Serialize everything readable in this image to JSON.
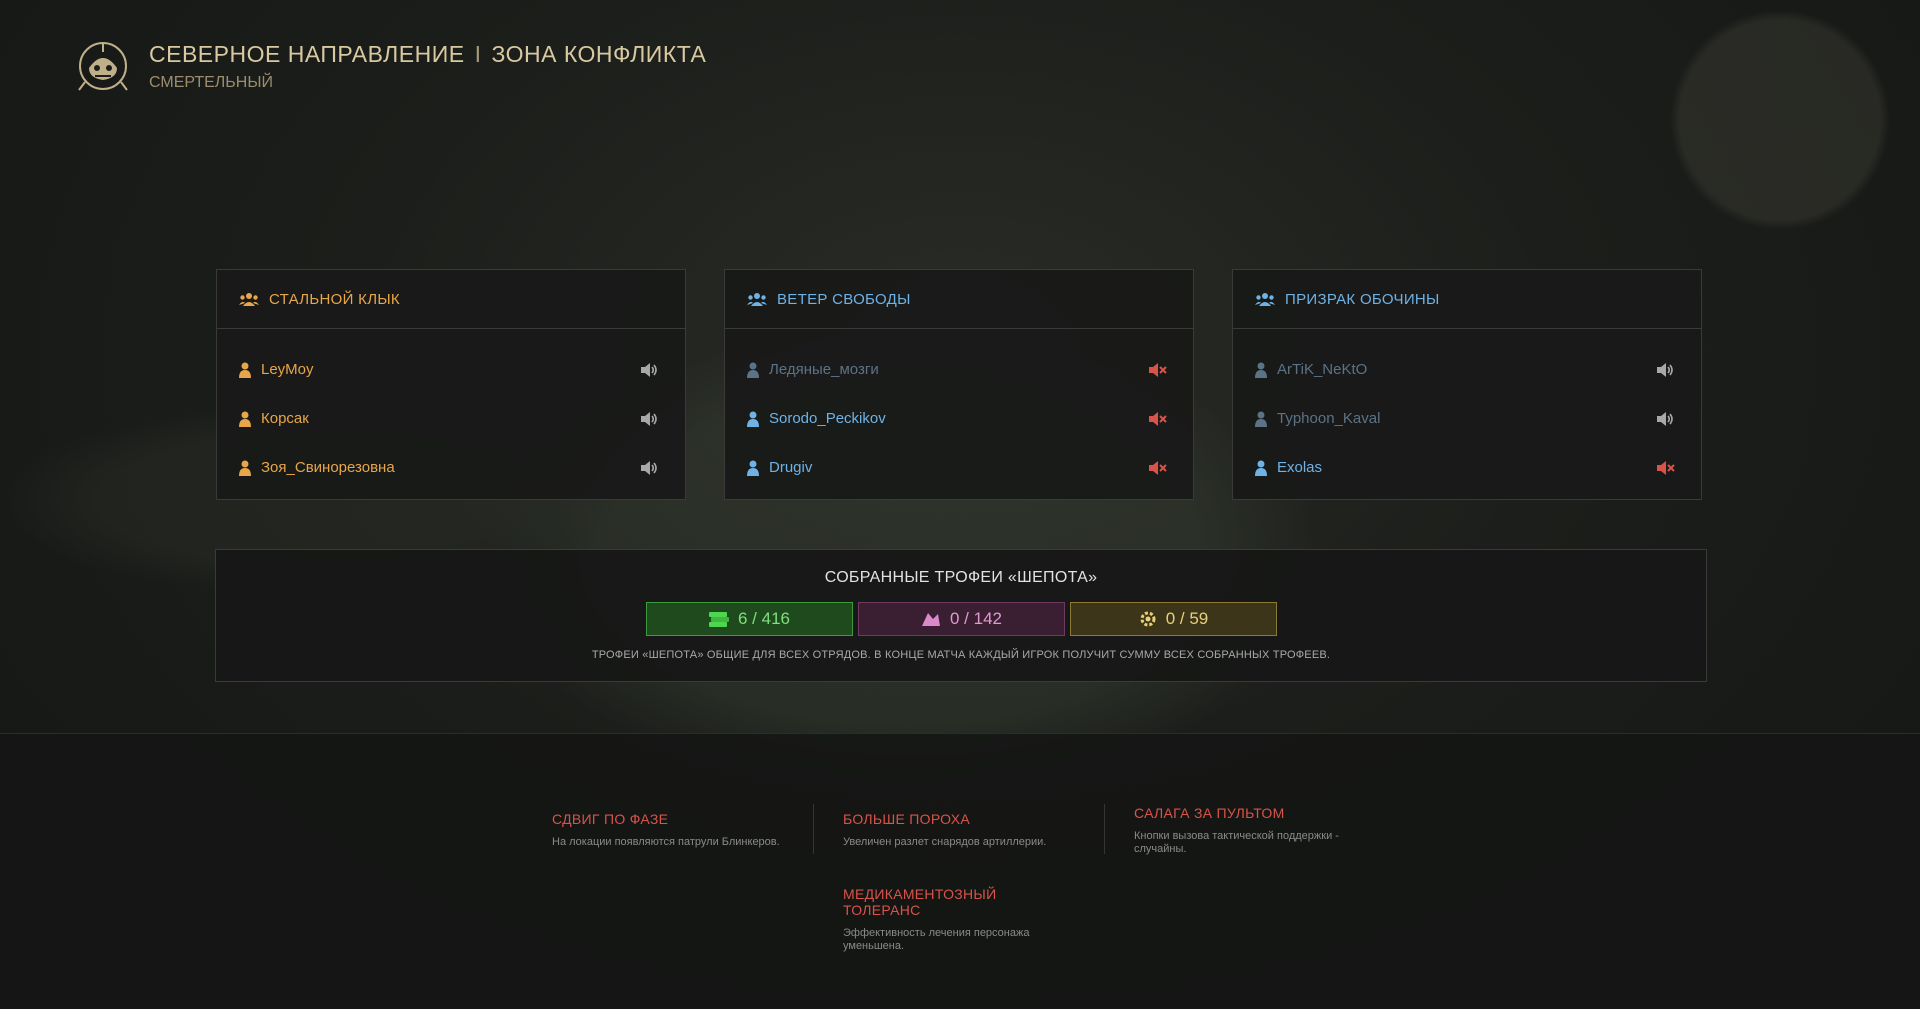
{
  "header": {
    "title_left": "СЕВЕРНОЕ НАПРАВЛЕНИЕ",
    "title_sep": "I",
    "title_right": "ЗОНА КОНФЛИКТА",
    "difficulty": "СМЕРТЕЛЬНЫЙ",
    "emblem_icon": "skull-emblem-icon"
  },
  "colors": {
    "accent_gold": "#d9c9a0",
    "squad_orange": "#e7a64a",
    "squad_blue": "#6fb2e6",
    "muted_player": "#5c7387",
    "muted_red": "#d9534a"
  },
  "squads": [
    {
      "name": "СТАЛЬНОЙ КЛЫК",
      "color": "#e7a64a",
      "players": [
        {
          "name": "LeyMoy",
          "muted": false,
          "dim": false
        },
        {
          "name": "Корсак",
          "muted": false,
          "dim": false
        },
        {
          "name": "Зоя_Свинорезовна",
          "muted": false,
          "dim": false
        }
      ]
    },
    {
      "name": "ВЕТЕР СВОБОДЫ",
      "color": "#6fb2e6",
      "players": [
        {
          "name": "Ледяные_мозги",
          "muted": true,
          "dim": true
        },
        {
          "name": "Sorodo_Peckikov",
          "muted": true,
          "dim": false
        },
        {
          "name": "Drugiv",
          "muted": true,
          "dim": false
        }
      ]
    },
    {
      "name": "ПРИЗРАК ОБОЧИНЫ",
      "color": "#6fb2e6",
      "players": [
        {
          "name": "ArTiK_NeKtO",
          "muted": false,
          "dim": true
        },
        {
          "name": "Typhoon_Kaval",
          "muted": false,
          "dim": true
        },
        {
          "name": "Exolas",
          "muted": true,
          "dim": false
        }
      ]
    }
  ],
  "trophies": {
    "title": "СОБРАННЫЕ ТРОФЕИ «ШЕПОТА»",
    "counters": [
      {
        "icon": "cash-stack-icon",
        "value": "6 / 416",
        "style": "green"
      },
      {
        "icon": "pink-trophy-icon",
        "value": "0 / 142",
        "style": "pink"
      },
      {
        "icon": "gear-trophy-icon",
        "value": "0 / 59",
        "style": "gold"
      }
    ],
    "note": "ТРОФЕИ «ШЕПОТА» ОБЩИЕ ДЛЯ ВСЕХ ОТРЯДОВ. В КОНЦЕ МАТЧА КАЖДЫЙ ИГРОК ПОЛУЧИТ СУММУ ВСЕХ СОБРАННЫХ ТРОФЕЕВ."
  },
  "modifiers": [
    {
      "title": "СДВИГ ПО ФАЗЕ",
      "desc": "На локации появляются патрули Блинкеров."
    },
    {
      "title": "БОЛЬШЕ ПОРОХА",
      "desc": "Увеличен разлет снарядов артиллерии."
    },
    {
      "title": "САЛАГА ЗА ПУЛЬТОМ",
      "desc": "Кнопки вызова тактической поддержки - случайны."
    },
    {
      "title": "МЕДИКАМЕНТОЗНЫЙ ТОЛЕРАНС",
      "desc": "Эффективность лечения персонажа уменьшена."
    }
  ]
}
